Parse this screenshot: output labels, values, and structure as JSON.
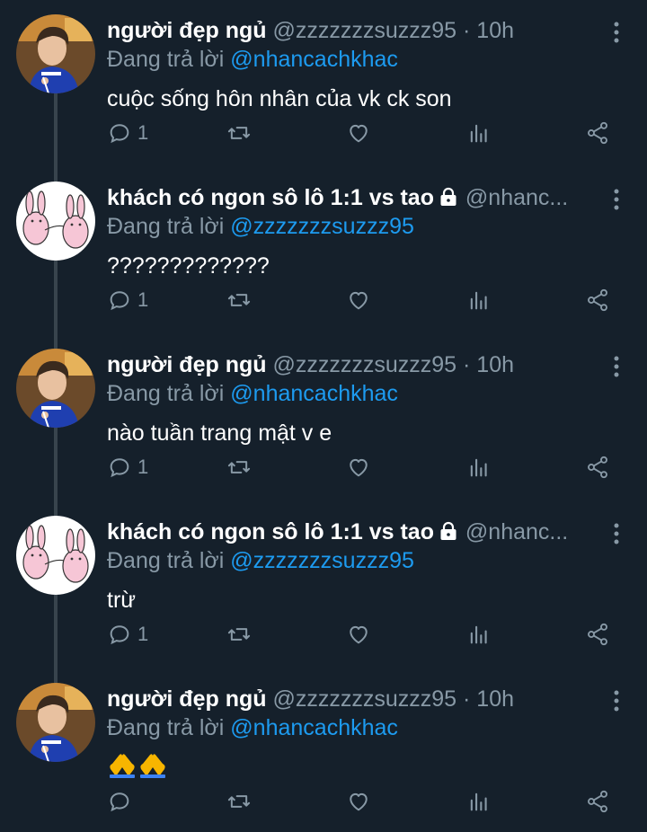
{
  "reply_prefix": "Đang trả lời",
  "tweets": [
    {
      "name": "người đẹp ngủ",
      "handle": "@zzzzzzzsuzzz95",
      "dot": "·",
      "time": "10h",
      "replying_to": "@nhancachkhac",
      "text": "cuộc sống hôn nhân của vk ck son",
      "reply_count": "1",
      "avatar": "person-photo",
      "locked": false
    },
    {
      "name": "khách có ngon sô lô 1:1 vs tao",
      "handle": "@nhanc...",
      "dot": "",
      "time": "",
      "replying_to": "@zzzzzzzsuzzz95",
      "text": "?????????????",
      "reply_count": "1",
      "avatar": "rabbits-cartoon",
      "locked": true
    },
    {
      "name": "người đẹp ngủ",
      "handle": "@zzzzzzzsuzzz95",
      "dot": "·",
      "time": "10h",
      "replying_to": "@nhancachkhac",
      "text": "nào tuần trang mật v e",
      "reply_count": "1",
      "avatar": "person-photo",
      "locked": false
    },
    {
      "name": "khách có ngon sô lô 1:1 vs tao",
      "handle": "@nhanc...",
      "dot": "",
      "time": "",
      "replying_to": "@zzzzzzzsuzzz95",
      "text": "trừ",
      "reply_count": "1",
      "avatar": "rabbits-cartoon",
      "locked": true
    },
    {
      "name": "người đẹp ngủ",
      "handle": "@zzzzzzzsuzzz95",
      "dot": "·",
      "time": "10h",
      "replying_to": "@nhancachkhac",
      "text": "🙏🙏",
      "reply_count": "",
      "avatar": "person-photo",
      "locked": false
    }
  ],
  "icons": {
    "reply": "comment-icon",
    "retweet": "retweet-icon",
    "like": "heart-icon",
    "views": "analytics-icon",
    "share": "share-icon",
    "more": "more-vertical-icon",
    "lock": "lock-icon"
  },
  "colors": {
    "background": "#15202b",
    "text": "#ffffff",
    "secondary": "#8899a6",
    "mention": "#1d9bf0",
    "thread_line": "#38444d"
  }
}
